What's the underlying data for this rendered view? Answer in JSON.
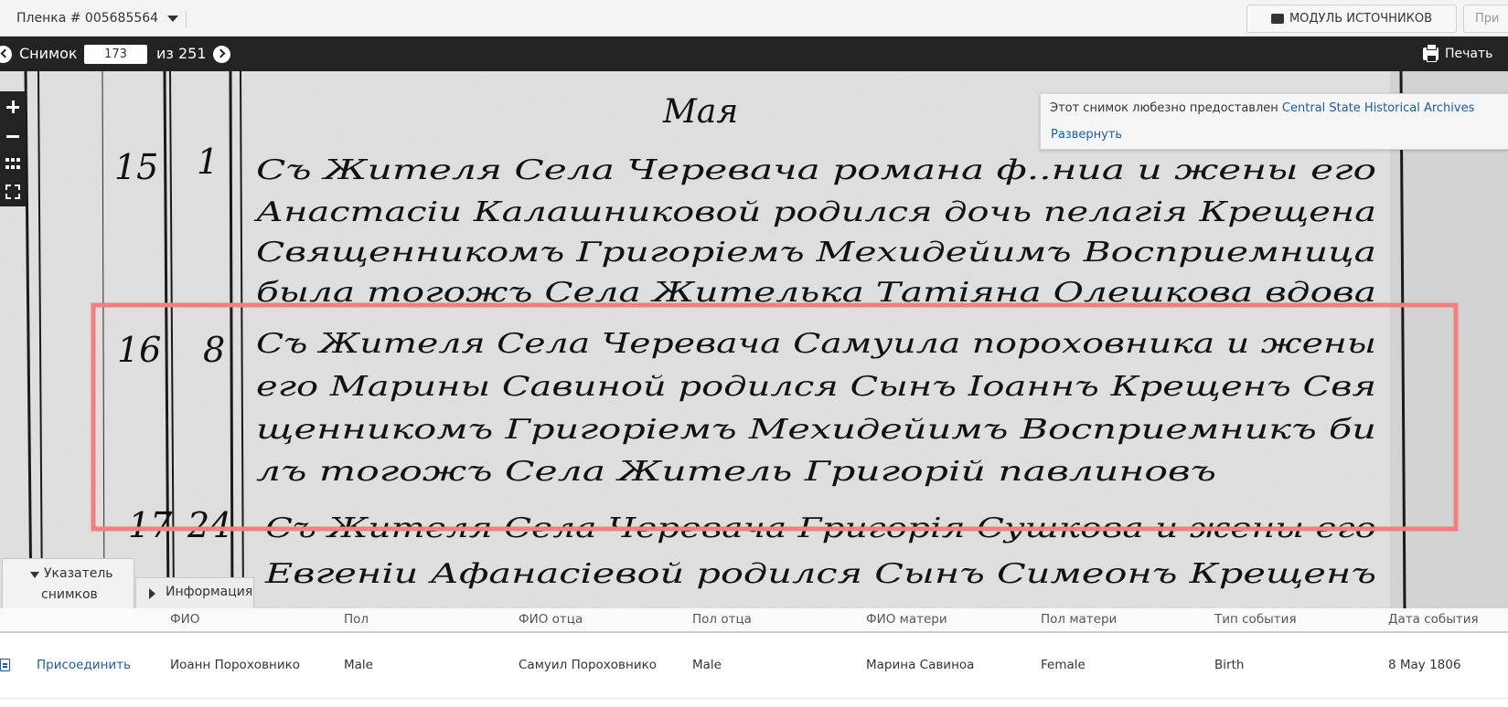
{
  "header": {
    "film_label": "Пленка # 005685564",
    "source_module_button": "МОДУЛЬ ИСТОЧНИКОВ",
    "partial_button": "При"
  },
  "navbar": {
    "image_label": "Снимок",
    "current_image": "173",
    "of_total": "из 251",
    "print_label": "Печать"
  },
  "viewer": {
    "heading_script": "Мая",
    "entries": [
      {
        "number": "15",
        "day": "1",
        "lines": [
          "Съ Жителя Села Черевача романа ф..ниа и жены его",
          "Анастасіи Калашниковой родился дочь пелагія Крещена",
          "Священникомъ Григоріемъ Мехидейимъ Восприемница",
          "была тогожъ Села Жителька Татіяна Олешкова вдова"
        ]
      },
      {
        "number": "16",
        "day": "8",
        "lines": [
          "Съ Жителя Села Черевача Самуила пороховника и жены",
          "его Марины Савиной родился Сынъ Іоаннъ Крещенъ Свя",
          "щенникомъ Григоріемъ Мехидейимъ Восприемникъ би",
          "лъ тогожъ Села Житель Григорій павлиновъ"
        ]
      },
      {
        "number": "17",
        "day": "24",
        "lines": [
          "Съ Жителя Села Черевача Григорія Сушкова и жены его",
          "Евгеніи Афанасіевой родился Сынъ Симеонъ Крещенъ"
        ]
      }
    ],
    "credit": {
      "text": "Этот снимок любезно предоставлен",
      "link": "Central State Historical Archives",
      "expand": "Развернуть"
    },
    "tabs": {
      "index_line1": "Указатель",
      "index_line2": "снимков",
      "info": "Информация"
    },
    "highlight_color": "#f08080"
  },
  "table": {
    "columns": [
      "ФИО",
      "Пол",
      "ФИО отца",
      "Пол отца",
      "ФИО матери",
      "Пол матери",
      "Тип события",
      "Дата события"
    ],
    "row": {
      "action": "Присоединить",
      "cells": [
        "Иоанн Пороховнико",
        "Male",
        "Самуил Пороховнико",
        "Male",
        "Марина Савиноа",
        "Female",
        "Birth",
        "8 May 1806"
      ]
    }
  },
  "colors": {
    "accent_link": "#1a5cab",
    "toolbar_dark": "#232323"
  }
}
